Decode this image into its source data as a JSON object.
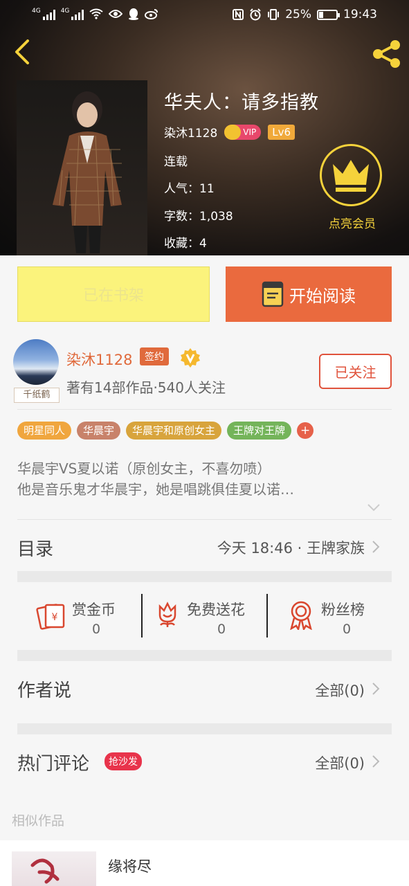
{
  "status_bar": {
    "network_1": "4G",
    "network_2": "4G",
    "battery": "25%",
    "time": "19:43"
  },
  "book": {
    "title": "华夫人：请多指教",
    "author": "染沐1128",
    "vip_label": "VIP",
    "level": "Lv6",
    "status": "连载",
    "popularity_label": "人气：",
    "popularity": "11",
    "words_label": "字数：",
    "words": "1,038",
    "favorites_label": "收藏：",
    "favorites": "4",
    "member_cta": "点亮会员"
  },
  "actions": {
    "shelf_label": "已在书架",
    "read_label": "开始阅读"
  },
  "author_card": {
    "name": "染沐1128",
    "signed_label": "签约",
    "avatar_tag": "千纸鹤",
    "stats": "著有14部作品·540人关注",
    "follow_label": "已关注"
  },
  "tags": [
    {
      "label": "明星同人",
      "color": "#f0a63e"
    },
    {
      "label": "华晨宇",
      "color": "#c8826a"
    },
    {
      "label": "华晨宇和原创女主",
      "color": "#d8a43c"
    },
    {
      "label": "王牌对王牌",
      "color": "#74b45a"
    }
  ],
  "tag_more": "+",
  "description": {
    "line1": "华晨宇VS夏以诺（原创女主，不喜勿喷）",
    "line2": "他是音乐鬼才华晨宇，她是唱跳俱佳夏以诺…"
  },
  "catalog": {
    "title": "目录",
    "latest": "今天 18:46 · 王牌家族"
  },
  "stats": [
    {
      "label": "赏金币",
      "value": "0",
      "icon": "gift-envelope-icon"
    },
    {
      "label": "免费送花",
      "value": "0",
      "icon": "flower-icon"
    },
    {
      "label": "粉丝榜",
      "value": "0",
      "icon": "ribbon-medal-icon"
    }
  ],
  "author_says": {
    "title": "作者说",
    "all": "全部(0)"
  },
  "hot_comments": {
    "title": "热门评论",
    "badge": "抢沙发",
    "all": "全部(0)"
  },
  "similar": {
    "title": "相似作品",
    "items": [
      {
        "title": "缘将尽"
      }
    ]
  },
  "colors": {
    "accent": "#ea6a3e",
    "shelf_bg": "#fbf37c",
    "gold": "#f5d23b"
  }
}
